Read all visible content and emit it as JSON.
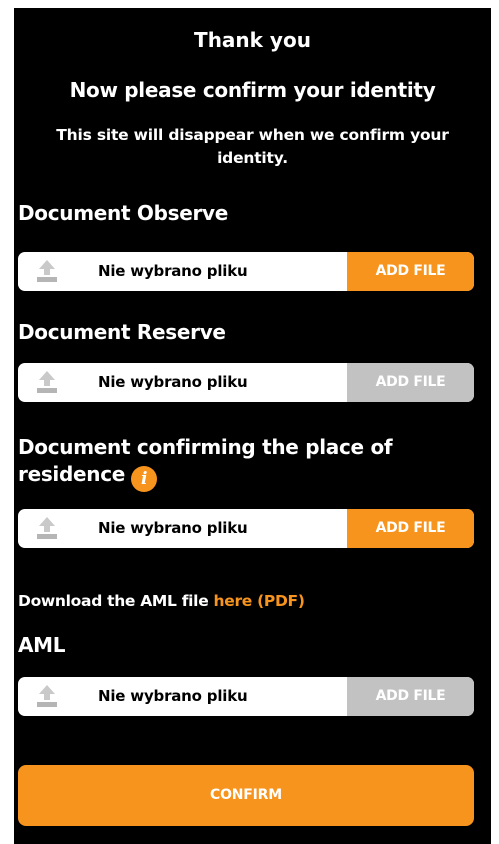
{
  "header": {
    "title": "Thank you",
    "subtitle": "Now please confirm your identity",
    "notice": "This site will disappear when we confirm your identity."
  },
  "documents": [
    {
      "label": "Document Observe",
      "file_status": "Nie wybrano pliku",
      "button_label": "ADD FILE",
      "button_state": "active"
    },
    {
      "label": "Document Reserve",
      "file_status": "Nie wybrano pliku",
      "button_label": "ADD FILE",
      "button_state": "disabled"
    },
    {
      "label": "Document confirming the place of residence",
      "info_icon_glyph": "i",
      "file_status": "Nie wybrano pliku",
      "button_label": "ADD FILE",
      "button_state": "active"
    },
    {
      "label": "AML",
      "file_status": "Nie wybrano pliku",
      "button_label": "ADD FILE",
      "button_state": "disabled"
    }
  ],
  "aml_download": {
    "prefix": "Download the AML file ",
    "link_text": "here (PDF)"
  },
  "confirm_label": "CONFIRM",
  "colors": {
    "background": "#000000",
    "accent": "#f7941d",
    "disabled": "#c2c2c2",
    "text": "#ffffff",
    "field": "#ffffff"
  },
  "icons": {
    "upload": "upload-icon",
    "info": "info-icon"
  }
}
